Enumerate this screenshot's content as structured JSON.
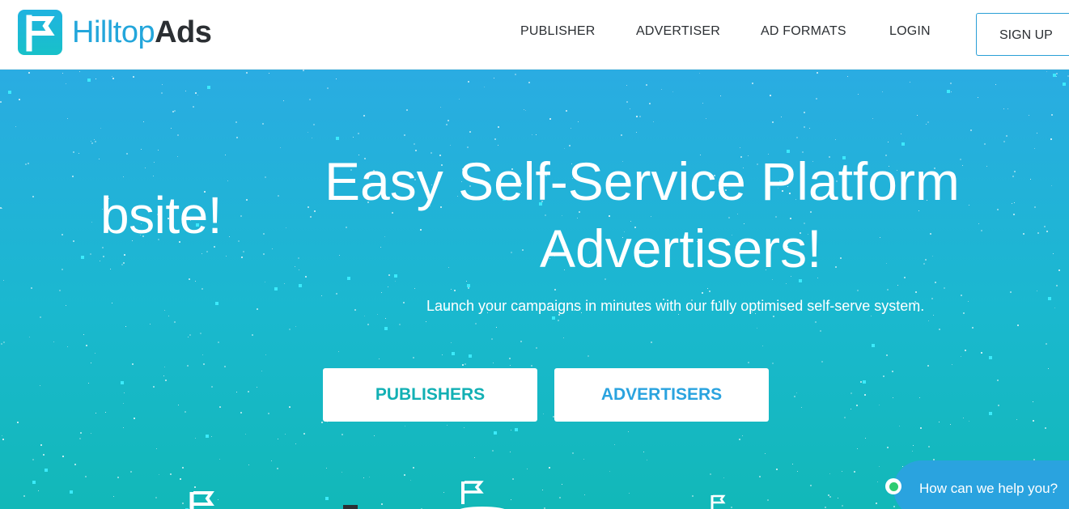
{
  "header": {
    "logo": {
      "part1": "Hilltop",
      "part2": "Ads",
      "icon": "flag-logo-icon"
    },
    "nav": [
      {
        "label": "PUBLISHER"
      },
      {
        "label": "ADVERTISER"
      },
      {
        "label": "AD FORMATS"
      },
      {
        "label": "LOGIN"
      }
    ],
    "signup_label": "SIGN UP"
  },
  "hero": {
    "ghost_left": "bsite!",
    "title_line1": "Easy Self-Service Platform",
    "title_line2": "Advertisers!",
    "subtitle": "Launch your campaigns in minutes with our fully optimised self-serve system.",
    "buttons": {
      "publishers": "PUBLISHERS",
      "advertisers": "ADVERTISERS"
    }
  },
  "chat": {
    "label": "How can we help you?",
    "status_color": "#2ecc71"
  },
  "colors": {
    "brand_blue": "#23a6db",
    "brand_teal": "#12b0b4",
    "dark_text": "#2b2f33"
  }
}
